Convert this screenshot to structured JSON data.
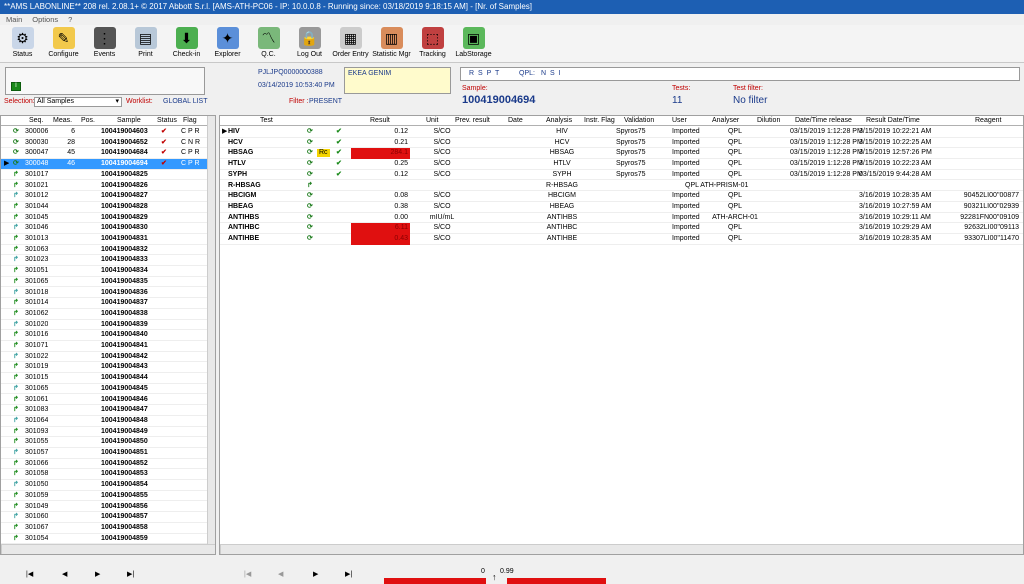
{
  "window": {
    "title": "**AMS LABONLINE** 208  rel. 2.08.1+  © 2017 Abbott S.r.l.  [AMS-ATH-PC06 - IP: 10.0.0.8  - Running since: 03/18/2019 9:18:15 AM] - [Nr. of Samples]"
  },
  "menu": [
    "Main",
    "Options",
    "?"
  ],
  "toolbar": [
    {
      "label": "Status",
      "icon": "status-icon",
      "color": "#c9d6e8"
    },
    {
      "label": "Configure",
      "icon": "configure-icon",
      "color": "#f2c94c"
    },
    {
      "label": "Events",
      "icon": "traffic-light-icon",
      "color": "#555555"
    },
    {
      "label": "Print",
      "icon": "printer-icon",
      "color": "#b8c8d8"
    },
    {
      "label": "Check-in",
      "icon": "check-in-icon",
      "color": "#4caf50"
    },
    {
      "label": "Explorer",
      "icon": "explorer-icon",
      "color": "#5b8fd9"
    },
    {
      "label": "Q.C.",
      "icon": "qc-chart-icon",
      "color": "#7ab87a"
    },
    {
      "label": "Log Out",
      "icon": "lock-icon",
      "color": "#999999"
    },
    {
      "label": "Order Entry",
      "icon": "order-entry-icon",
      "color": "#cccccc"
    },
    {
      "label": "Statistic Mgr",
      "icon": "statistics-icon",
      "color": "#d98c5b"
    },
    {
      "label": "Tracking",
      "icon": "tracking-icon",
      "color": "#c04040"
    },
    {
      "label": "LabStorage",
      "icon": "labstorage-icon",
      "color": "#5bb85b"
    }
  ],
  "info": {
    "barcode": "PJLJPQ0000000388",
    "datetime": "03/14/2019 10:53:40 PM",
    "patient": "EKEA GENIM",
    "flags_left": "R S P T",
    "qpl_label": "QPL:",
    "flags_right": "N S I",
    "sample_label": "Sample:",
    "sample_value": "100419004694",
    "tests_label": "Tests:",
    "tests_value": "11",
    "testfilter_label": "Test filter:",
    "testfilter_value": "No filter",
    "selection_label": "Selection:",
    "selection_value": "All Samples",
    "worklist_label": "Worklist:",
    "worklist_value": "GLOBAL LIST",
    "filter_label": "Filter :",
    "filter_value": "PRESENT"
  },
  "left_headers": [
    "Seq.",
    "Meas.",
    "Pos.",
    "Sample",
    "Status",
    "Flag"
  ],
  "left_rows": [
    {
      "seq": "300006",
      "meas": "6",
      "pos": "",
      "sample": "100419004603",
      "status": "check",
      "flag": "C P R"
    },
    {
      "seq": "300030",
      "meas": "28",
      "pos": "",
      "sample": "100419004652",
      "status": "check",
      "flag": "C N R"
    },
    {
      "seq": "300047",
      "meas": "45",
      "pos": "",
      "sample": "100419004684",
      "status": "check",
      "flag": "C P R"
    },
    {
      "seq": "300048",
      "meas": "46",
      "pos": "",
      "sample": "100419004694",
      "status": "check",
      "flag": "C P R"
    },
    {
      "seq": "301017",
      "meas": "",
      "pos": "",
      "sample": "100419004825",
      "status": "",
      "flag": ""
    },
    {
      "seq": "301021",
      "meas": "",
      "pos": "",
      "sample": "100419004826",
      "status": "",
      "flag": ""
    },
    {
      "seq": "301012",
      "meas": "",
      "pos": "",
      "sample": "100419004827",
      "status": "",
      "flag": ""
    },
    {
      "seq": "301044",
      "meas": "",
      "pos": "",
      "sample": "100419004828",
      "status": "",
      "flag": ""
    },
    {
      "seq": "301045",
      "meas": "",
      "pos": "",
      "sample": "100419004829",
      "status": "",
      "flag": ""
    },
    {
      "seq": "301046",
      "meas": "",
      "pos": "",
      "sample": "100419004830",
      "status": "",
      "flag": ""
    },
    {
      "seq": "301013",
      "meas": "",
      "pos": "",
      "sample": "100419004831",
      "status": "",
      "flag": ""
    },
    {
      "seq": "301063",
      "meas": "",
      "pos": "",
      "sample": "100419004832",
      "status": "",
      "flag": ""
    },
    {
      "seq": "301023",
      "meas": "",
      "pos": "",
      "sample": "100419004833",
      "status": "",
      "flag": ""
    },
    {
      "seq": "301051",
      "meas": "",
      "pos": "",
      "sample": "100419004834",
      "status": "",
      "flag": ""
    },
    {
      "seq": "301065",
      "meas": "",
      "pos": "",
      "sample": "100419004835",
      "status": "",
      "flag": ""
    },
    {
      "seq": "301018",
      "meas": "",
      "pos": "",
      "sample": "100419004836",
      "status": "",
      "flag": ""
    },
    {
      "seq": "301014",
      "meas": "",
      "pos": "",
      "sample": "100419004837",
      "status": "",
      "flag": ""
    },
    {
      "seq": "301062",
      "meas": "",
      "pos": "",
      "sample": "100419004838",
      "status": "",
      "flag": ""
    },
    {
      "seq": "301020",
      "meas": "",
      "pos": "",
      "sample": "100419004839",
      "status": "",
      "flag": ""
    },
    {
      "seq": "301016",
      "meas": "",
      "pos": "",
      "sample": "100419004840",
      "status": "",
      "flag": ""
    },
    {
      "seq": "301071",
      "meas": "",
      "pos": "",
      "sample": "100419004841",
      "status": "",
      "flag": ""
    },
    {
      "seq": "301022",
      "meas": "",
      "pos": "",
      "sample": "100419004842",
      "status": "",
      "flag": ""
    },
    {
      "seq": "301019",
      "meas": "",
      "pos": "",
      "sample": "100419004843",
      "status": "",
      "flag": ""
    },
    {
      "seq": "301015",
      "meas": "",
      "pos": "",
      "sample": "100419004844",
      "status": "",
      "flag": ""
    },
    {
      "seq": "301065",
      "meas": "",
      "pos": "",
      "sample": "100419004845",
      "status": "",
      "flag": ""
    },
    {
      "seq": "301061",
      "meas": "",
      "pos": "",
      "sample": "100419004846",
      "status": "",
      "flag": ""
    },
    {
      "seq": "301083",
      "meas": "",
      "pos": "",
      "sample": "100419004847",
      "status": "",
      "flag": ""
    },
    {
      "seq": "301064",
      "meas": "",
      "pos": "",
      "sample": "100419004848",
      "status": "",
      "flag": ""
    },
    {
      "seq": "301093",
      "meas": "",
      "pos": "",
      "sample": "100419004849",
      "status": "",
      "flag": ""
    },
    {
      "seq": "301055",
      "meas": "",
      "pos": "",
      "sample": "100419004850",
      "status": "",
      "flag": ""
    },
    {
      "seq": "301057",
      "meas": "",
      "pos": "",
      "sample": "100419004851",
      "status": "",
      "flag": ""
    },
    {
      "seq": "301066",
      "meas": "",
      "pos": "",
      "sample": "100419004852",
      "status": "",
      "flag": ""
    },
    {
      "seq": "301058",
      "meas": "",
      "pos": "",
      "sample": "100419004853",
      "status": "",
      "flag": ""
    },
    {
      "seq": "301050",
      "meas": "",
      "pos": "",
      "sample": "100419004854",
      "status": "",
      "flag": ""
    },
    {
      "seq": "301059",
      "meas": "",
      "pos": "",
      "sample": "100419004855",
      "status": "",
      "flag": ""
    },
    {
      "seq": "301049",
      "meas": "",
      "pos": "",
      "sample": "100419004856",
      "status": "",
      "flag": ""
    },
    {
      "seq": "301060",
      "meas": "",
      "pos": "",
      "sample": "100419004857",
      "status": "",
      "flag": ""
    },
    {
      "seq": "301067",
      "meas": "",
      "pos": "",
      "sample": "100419004858",
      "status": "",
      "flag": ""
    },
    {
      "seq": "301054",
      "meas": "",
      "pos": "",
      "sample": "100419004859",
      "status": "",
      "flag": ""
    }
  ],
  "right_headers": [
    "Test",
    "Result",
    "Unit",
    "Prev. result",
    "Date",
    "Analysis",
    "Instr. Flag",
    "Validation",
    "User",
    "Analyser",
    "Dilution",
    "Date/Time release",
    "Result Date/Time",
    "Reagent"
  ],
  "right_rows": [
    {
      "test": "HIV",
      "extra": "",
      "check": true,
      "result": "0.12",
      "red": false,
      "unit": "S/CO",
      "analysis": "HIV",
      "validation": "Spyros75",
      "user": "Imported",
      "analyser": "QPL",
      "release": "03/15/2019 1:12:28 PM",
      "resdt": "3/15/2019 10:22:21 AM",
      "reagent": ""
    },
    {
      "test": "HCV",
      "extra": "",
      "check": true,
      "result": "0.21",
      "red": false,
      "unit": "S/CO",
      "analysis": "HCV",
      "validation": "Spyros75",
      "user": "Imported",
      "analyser": "QPL",
      "release": "03/15/2019 1:12:28 PM",
      "resdt": "3/15/2019 10:22:25 AM",
      "reagent": ""
    },
    {
      "test": "HBSAG",
      "extra": "Rc",
      "check": true,
      "result": "284.1",
      "red": true,
      "unit": "S/CO",
      "analysis": "HBSAG",
      "validation": "Spyros75",
      "user": "Imported",
      "analyser": "QPL",
      "release": "03/15/2019 1:12:28 PM",
      "resdt": "3/15/2019 12:57:26 PM",
      "reagent": ""
    },
    {
      "test": "HTLV",
      "extra": "",
      "check": true,
      "result": "0.25",
      "red": false,
      "unit": "S/CO",
      "analysis": "HTLV",
      "validation": "Spyros75",
      "user": "Imported",
      "analyser": "QPL",
      "release": "03/15/2019 1:12:28 PM",
      "resdt": "3/15/2019 10:22:23 AM",
      "reagent": ""
    },
    {
      "test": "SYPH",
      "extra": "",
      "check": true,
      "result": "0.12",
      "red": false,
      "unit": "S/CO",
      "analysis": "SYPH",
      "validation": "Spyros75",
      "user": "Imported",
      "analyser": "QPL",
      "release": "03/15/2019 1:12:28 PM",
      "resdt": "03/15/2019 9:44:28 AM",
      "reagent": ""
    },
    {
      "test": "R-HBSAG",
      "extra": "",
      "check": false,
      "result": "",
      "red": false,
      "unit": "",
      "analysis": "R-HBSAG",
      "validation": "",
      "user": "",
      "analyser": "QPL ATH-PRISM-01",
      "release": "",
      "resdt": "",
      "reagent": ""
    },
    {
      "test": "HBCIGM",
      "extra": "",
      "check": false,
      "result": "0.08",
      "red": false,
      "unit": "S/CO",
      "analysis": "HBCIGM",
      "validation": "",
      "user": "Imported",
      "analyser": "QPL",
      "release": "",
      "resdt": "3/16/2019 10:28:35 AM",
      "reagent": "90452LI00''00877"
    },
    {
      "test": "HBEAG",
      "extra": "",
      "check": false,
      "result": "0.38",
      "red": false,
      "unit": "S/CO",
      "analysis": "HBEAG",
      "validation": "",
      "user": "Imported",
      "analyser": "QPL",
      "release": "",
      "resdt": "3/16/2019 10:27:59 AM",
      "reagent": "90321LI00''02939"
    },
    {
      "test": "ANTIHBS",
      "extra": "",
      "check": false,
      "result": "0.00",
      "red": false,
      "unit": "mIU/mL",
      "analysis": "ANTIHBS",
      "validation": "",
      "user": "Imported",
      "analyser": "ATH-ARCH-01",
      "release": "",
      "resdt": "3/16/2019 10:29:11 AM",
      "reagent": "92281FN00''09109"
    },
    {
      "test": "ANTIHBC",
      "extra": "",
      "check": false,
      "result": "6.11",
      "red": true,
      "unit": "S/CO",
      "analysis": "ANTIHBC",
      "validation": "",
      "user": "Imported",
      "analyser": "QPL",
      "release": "",
      "resdt": "3/16/2019 10:29:29 AM",
      "reagent": "92632LI00''09113"
    },
    {
      "test": "ANTIHBE",
      "extra": "",
      "check": false,
      "result": "0.43",
      "red": true,
      "unit": "S/CO",
      "analysis": "ANTIHBE",
      "validation": "",
      "user": "Imported",
      "analyser": "QPL",
      "release": "",
      "resdt": "3/16/2019 10:28:35 AM",
      "reagent": "93307LI00''11470"
    }
  ],
  "bottom": {
    "nav": [
      "|◀",
      "◀",
      "▶",
      "▶|"
    ],
    "nav2": [
      "|◀",
      "◀",
      "▶",
      "▶|"
    ],
    "scale_left": "0",
    "scale_right": "0.99"
  },
  "colors": {
    "title": "#1d5fb3",
    "selected_row": "#3399ff",
    "alert_red": "#e01010",
    "check_red": "#c00000",
    "check_green": "#1a8a1a"
  }
}
